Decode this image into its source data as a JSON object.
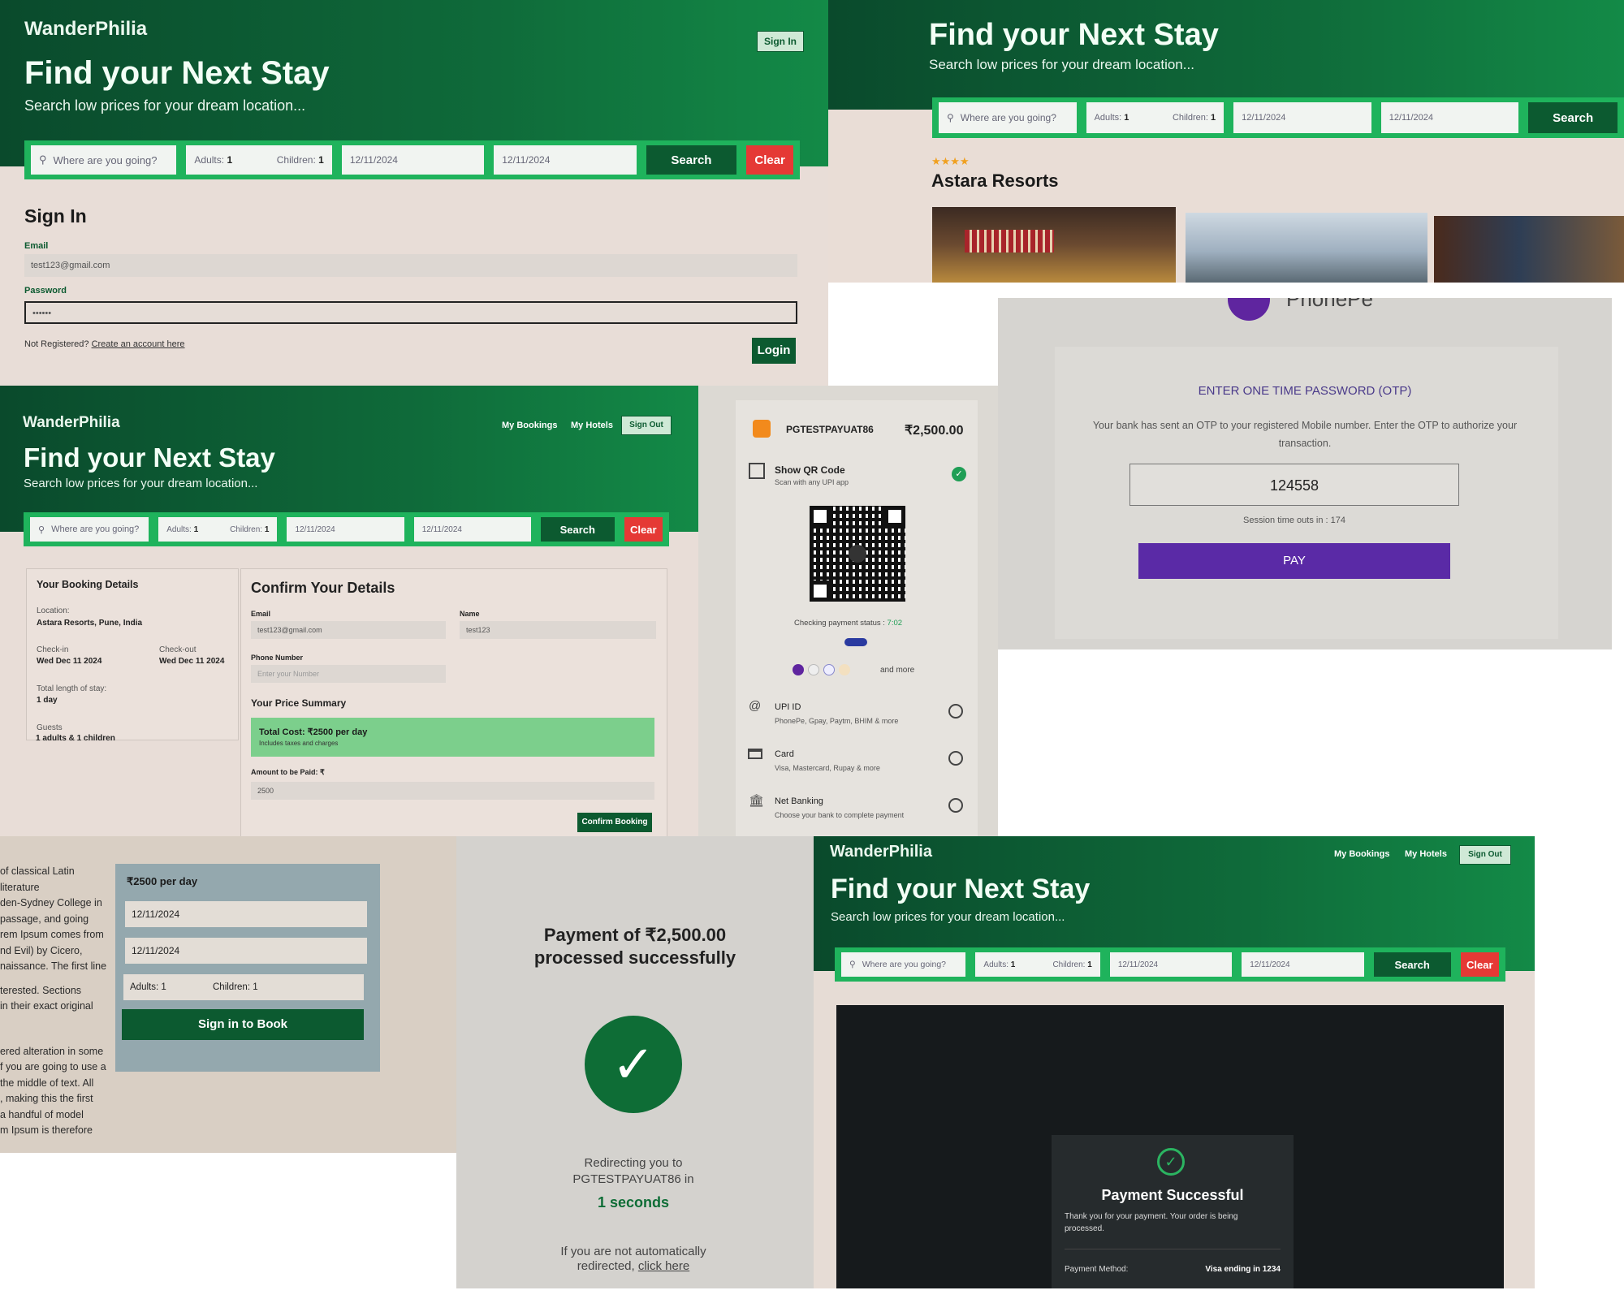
{
  "app": {
    "brand": "WanderPhilia",
    "hero_title": "Find your Next Stay",
    "hero_subtitle": "Search low prices for your dream location..."
  },
  "search": {
    "placeholder": "Where are you going?",
    "adults_label": "Adults:",
    "adults_value": "1",
    "children_label": "Children:",
    "children_value": "1",
    "checkin": "12/11/2024",
    "checkout": "12/11/2024",
    "search_label": "Search",
    "clear_label": "Clear"
  },
  "signin_page": {
    "nav_signin": "Sign In",
    "heading": "Sign In",
    "email_label": "Email",
    "email_value": "test123@gmail.com",
    "password_label": "Password",
    "password_value": "••••••",
    "not_registered": "Not Registered?",
    "create_link": "Create an account here",
    "login_label": "Login"
  },
  "hotel_page": {
    "stars": "★★★★",
    "hotel_name": "Astara Resorts"
  },
  "otp_page": {
    "brand_partial": "PhonePe",
    "heading": "ENTER ONE TIME PASSWORD (OTP)",
    "message": "Your bank has sent an OTP to your registered Mobile number. Enter the OTP to authorize your transaction.",
    "otp_value": "124558",
    "session_text": "Session time outs in : 174",
    "pay_label": "PAY"
  },
  "booking_page": {
    "nav_bookings": "My Bookings",
    "nav_hotels": "My Hotels",
    "nav_signout": "Sign Out",
    "details_heading": "Your Booking Details",
    "location_label": "Location:",
    "location_value": "Astara Resorts, Pune, India",
    "checkin_label": "Check-in",
    "checkin_value": "Wed Dec 11 2024",
    "checkout_label": "Check-out",
    "checkout_value": "Wed Dec 11 2024",
    "length_label": "Total length of stay:",
    "length_value": "1 day",
    "guests_label": "Guests",
    "guests_value": "1 adults & 1 children",
    "confirm_heading": "Confirm Your Details",
    "email_label": "Email",
    "email_value": "test123@gmail.com",
    "name_label": "Name",
    "name_value": "test123",
    "phone_label": "Phone Number",
    "phone_placeholder": "Enter your Number",
    "price_summary_heading": "Your Price Summary",
    "total_cost": "Total Cost: ₹2500 per day",
    "includes": "Includes taxes and charges",
    "amount_label": "Amount to be Paid: ₹",
    "amount_value": "2500",
    "confirm_button": "Confirm Booking"
  },
  "payment_page": {
    "merchant": "PGTESTPAYUAT86",
    "amount": "₹2,500.00",
    "qr_title": "Show QR Code",
    "qr_sub": "Scan with any UPI app",
    "checking": "Checking payment status :",
    "timer": "7:02",
    "and_more": "and more",
    "upi_title": "UPI ID",
    "upi_sub": "PhonePe, Gpay, Paytm, BHIM & more",
    "card_title": "Card",
    "card_sub": "Visa, Mastercard, Rupay & more",
    "nb_title": "Net Banking",
    "nb_sub": "Choose your bank to complete payment"
  },
  "book_card": {
    "lorem_lines": [
      "of classical Latin literature",
      "den-Sydney College in",
      "passage, and going",
      "rem Ipsum comes from",
      "nd Evil) by Cicero,",
      "naissance. The first line",
      "",
      "terested. Sections",
      "in their exact original",
      "",
      "",
      "ered alteration in some",
      "f you are going to use a",
      "the middle of text. All",
      ", making this the first",
      "a handful of model",
      "m Ipsum is therefore"
    ],
    "price": "₹2500 per day",
    "date1": "12/11/2024",
    "date2": "12/11/2024",
    "adults": "Adults: 1",
    "children": "Children: 1",
    "button": "Sign in to Book"
  },
  "success_page": {
    "title_line1": "Payment of ₹2,500.00",
    "title_line2": "processed successfully",
    "redirect_line1": "Redirecting you to",
    "redirect_line2": "PGTESTPAYUAT86 in",
    "seconds": "1 seconds",
    "manual_line1": "If you are not automatically",
    "manual_line2": "redirected,",
    "click_here": "click here"
  },
  "final_page": {
    "modal_title": "Payment Successful",
    "modal_text": "Thank you for your payment. Your order is being processed.",
    "method_label": "Payment Method:",
    "method_value": "Visa ending in 1234"
  }
}
